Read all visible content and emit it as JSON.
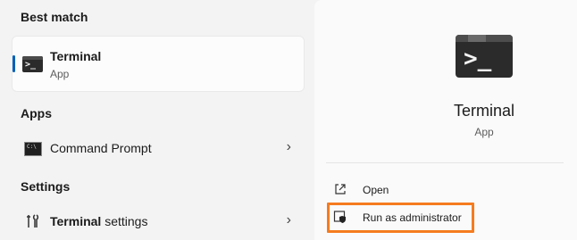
{
  "left": {
    "best_match_title": "Best match",
    "best_match": {
      "name": "Terminal",
      "type": "App",
      "icon": "terminal-icon"
    },
    "apps_title": "Apps",
    "apps": [
      {
        "label": "Command Prompt",
        "icon": "command-prompt-icon"
      }
    ],
    "settings_title": "Settings",
    "settings": [
      {
        "label_bold": "Terminal",
        "label_rest": " settings",
        "icon": "settings-icon"
      }
    ]
  },
  "detail": {
    "name": "Terminal",
    "type": "App",
    "actions": [
      {
        "label": "Open",
        "icon": "open-external-icon"
      },
      {
        "label": "Run as administrator",
        "icon": "shield-admin-icon"
      }
    ]
  },
  "colors": {
    "accent": "#005fb8",
    "highlight": "#f57c1f"
  }
}
